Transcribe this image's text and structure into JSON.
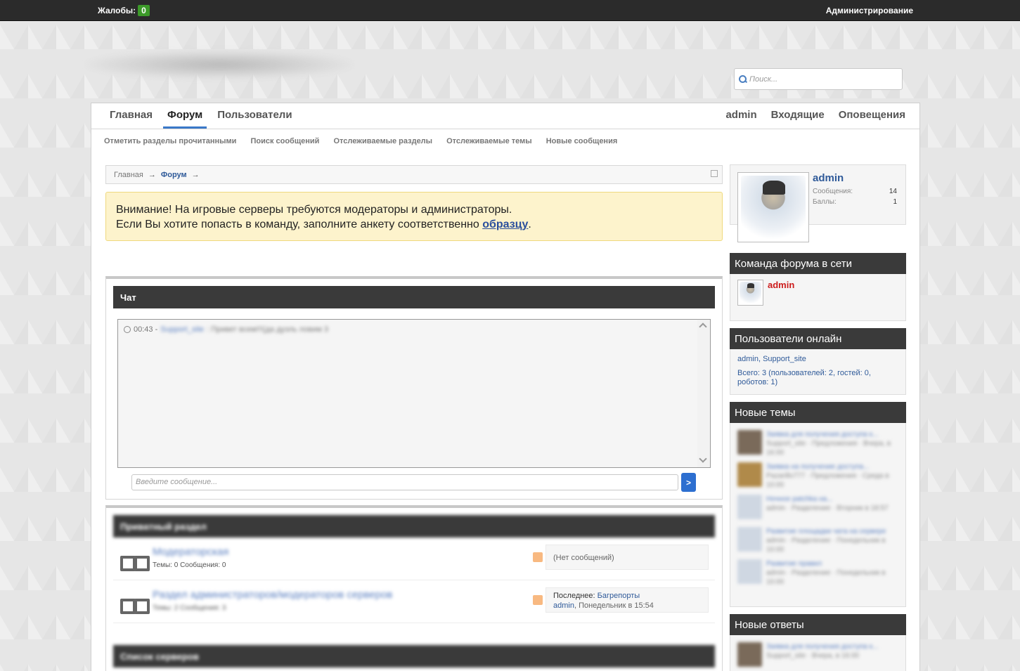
{
  "topbar": {
    "complaints_label": "Жалобы:",
    "complaints_count": "0",
    "admin_link": "Администрирование"
  },
  "search": {
    "placeholder": "Поиск..."
  },
  "nav": {
    "tabs": [
      "Главная",
      "Форум",
      "Пользователи"
    ],
    "active_tab": "Форум",
    "user_links": [
      "admin",
      "Входящие",
      "Оповещения"
    ]
  },
  "subnav": [
    "Отметить разделы прочитанными",
    "Поиск сообщений",
    "Отслеживаемые разделы",
    "Отслеживаемые темы",
    "Новые сообщения"
  ],
  "breadcrumb": {
    "home": "Главная",
    "current": "Форум",
    "arrow": "→"
  },
  "notice": {
    "line1": "Внимание! На игровые серверы требуются модераторы и администраторы.",
    "line2_prefix": "Если Вы хотите попасть в команду, заполните анкету соответственно ",
    "link": "образцу",
    "line2_suffix": "."
  },
  "chat": {
    "title": "Чат",
    "message": {
      "time": "00:43 -",
      "author": "Support_site",
      "text": ": Привет всем!!!(да дуэль ловим 3"
    },
    "input_placeholder": "Введите сообщение...",
    "send_label": ">"
  },
  "forum_category": {
    "title": "Приватный раздел",
    "nodes": [
      {
        "title": "Модераторская",
        "stats_themes_label": "Темы:",
        "themes": "0",
        "stats_msgs_label": "Сообщения:",
        "msgs": "0",
        "last": "(Нет сообщений)"
      },
      {
        "title": "Раздел администраторов/модераторов серверов",
        "stats_themes_label": "Темы:",
        "themes": "2",
        "stats_msgs_label": "Сообщения:",
        "msgs": "3",
        "last_label": "Последнее:",
        "last_thread": "Багрепорты",
        "last_user": "admin",
        "last_date": ", Понедельник в 15:54"
      }
    ]
  },
  "servers_category": {
    "title": "Список серверов"
  },
  "profile": {
    "name": "admin",
    "messages_label": "Сообщения:",
    "messages": "14",
    "points_label": "Баллы:",
    "points": "1"
  },
  "staff": {
    "title": "Команда форума в сети",
    "member": "admin"
  },
  "online": {
    "title": "Пользователи онлайн",
    "names": "admin, Support_site",
    "total": "Всего: 3 (пользователей: 2, гостей: 0, роботов: 1)"
  },
  "new_threads": {
    "title": "Новые темы",
    "items": [
      {
        "title": "Заявка для получения доступа к...",
        "meta": "Support_site · Предложения · Вчера, в 16:00"
      },
      {
        "title": "Заявка на получение доступа...",
        "meta": "Pazarillo777 · Предложения · Среда в 10:00"
      },
      {
        "title": "Ночное patchka на...",
        "meta": "admin · Разделение · Вторник в 18:57"
      },
      {
        "title": "Развитие площадки чата на сервере",
        "meta": "admin · Разделение · Понедельник в 10:00"
      },
      {
        "title": "Развитие правил",
        "meta": "admin · Разделение · Понедельник в 10:00"
      }
    ]
  },
  "new_replies": {
    "title": "Новые ответы",
    "items": [
      {
        "title": "Заявка для получения доступа к...",
        "meta": "Support_site · Вчера, в 16:00"
      }
    ]
  }
}
